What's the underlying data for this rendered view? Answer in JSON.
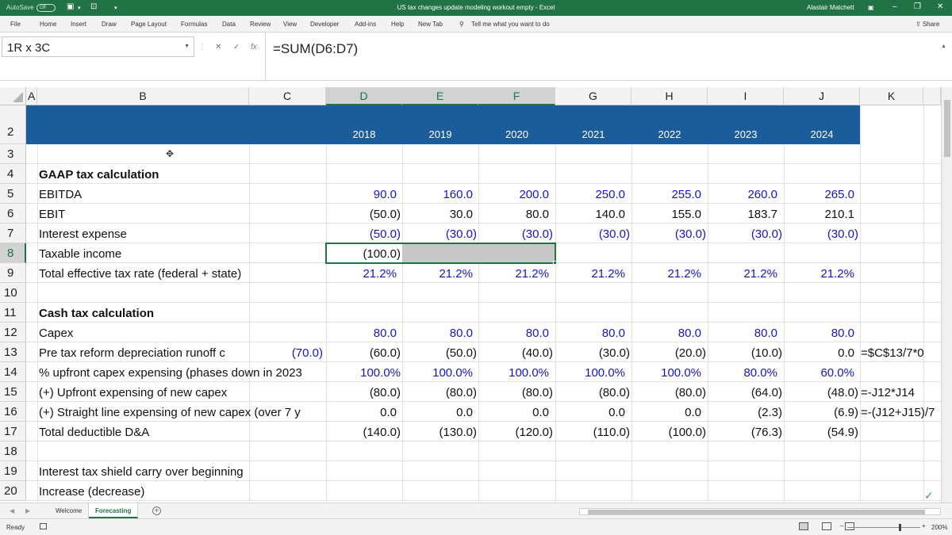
{
  "titlebar": {
    "autosave": "AutoSave",
    "autosave_state": "Off",
    "title": "US tax changes update modeling workout empty  -  Excel",
    "user": "Alastair Matchett"
  },
  "ribbon_tabs": [
    "File",
    "Home",
    "Insert",
    "Draw",
    "Page Layout",
    "Formulas",
    "Data",
    "Review",
    "View",
    "Developer",
    "Add-ins",
    "Help",
    "New Tab"
  ],
  "tell_me": "Tell me what you want to do",
  "share": "Share",
  "name_box": "1R x 3C",
  "formula": "=SUM(D6:D7)",
  "columns": [
    "A",
    "B",
    "C",
    "D",
    "E",
    "F",
    "G",
    "H",
    "I",
    "J",
    "K"
  ],
  "rows": [
    "2",
    "3",
    "4",
    "5",
    "6",
    "7",
    "8",
    "9",
    "10",
    "11",
    "12",
    "13",
    "14",
    "15",
    "16",
    "17",
    "18",
    "19",
    "20"
  ],
  "years": [
    "2018",
    "2019",
    "2020",
    "2021",
    "2022",
    "2023",
    "2024"
  ],
  "labels": {
    "r4": "GAAP tax calculation",
    "r5": "EBITDA",
    "r6": "EBIT",
    "r7": "Interest expense",
    "r8": "Taxable income",
    "r9": "Total effective tax rate (federal + state)",
    "r11": "Cash tax calculation",
    "r12": "Capex",
    "r13": "Pre tax reform depreciation runoff c",
    "r14": "% upfront capex expensing (phases down in 2023",
    "r15": "(+) Upfront expensing of new capex",
    "r16": "(+) Straight line expensing of new capex (over 7 y",
    "r17": "Total deductible D&A",
    "r19": "Interest tax shield carry over beginning",
    "r20": "Increase (decrease)"
  },
  "c13": "(70.0)",
  "values": {
    "r5": [
      "90.0",
      "160.0",
      "200.0",
      "250.0",
      "255.0",
      "260.0",
      "265.0"
    ],
    "r6": [
      "(50.0)",
      "30.0",
      "80.0",
      "140.0",
      "155.0",
      "183.7",
      "210.1"
    ],
    "r7": [
      "(50.0)",
      "(30.0)",
      "(30.0)",
      "(30.0)",
      "(30.0)",
      "(30.0)",
      "(30.0)"
    ],
    "r8": [
      "(100.0)"
    ],
    "r9": [
      "21.2%",
      "21.2%",
      "21.2%",
      "21.2%",
      "21.2%",
      "21.2%",
      "21.2%"
    ],
    "r12": [
      "80.0",
      "80.0",
      "80.0",
      "80.0",
      "80.0",
      "80.0",
      "80.0"
    ],
    "r13": [
      "(60.0)",
      "(50.0)",
      "(40.0)",
      "(30.0)",
      "(20.0)",
      "(10.0)",
      "0.0"
    ],
    "r14": [
      "100.0%",
      "100.0%",
      "100.0%",
      "100.0%",
      "100.0%",
      "80.0%",
      "60.0%"
    ],
    "r15": [
      "(80.0)",
      "(80.0)",
      "(80.0)",
      "(80.0)",
      "(80.0)",
      "(64.0)",
      "(48.0)"
    ],
    "r16": [
      "0.0",
      "0.0",
      "0.0",
      "0.0",
      "0.0",
      "(2.3)",
      "(6.9)"
    ],
    "r17": [
      "(140.0)",
      "(130.0)",
      "(120.0)",
      "(110.0)",
      "(100.0)",
      "(76.3)",
      "(54.9)"
    ]
  },
  "k_notes": {
    "r13": "=$C$13/7*0",
    "r15": "=-J12*J14",
    "r16": "=-(J12+J15)/7"
  },
  "sheets": [
    "Welcome",
    "Forecasting"
  ],
  "active_sheet": "Forecasting",
  "status": "Ready",
  "zoom": "200%",
  "colors": {
    "excel_green": "#217346",
    "banner_blue": "#1b5d9b",
    "input_blue": "#1515c8"
  }
}
